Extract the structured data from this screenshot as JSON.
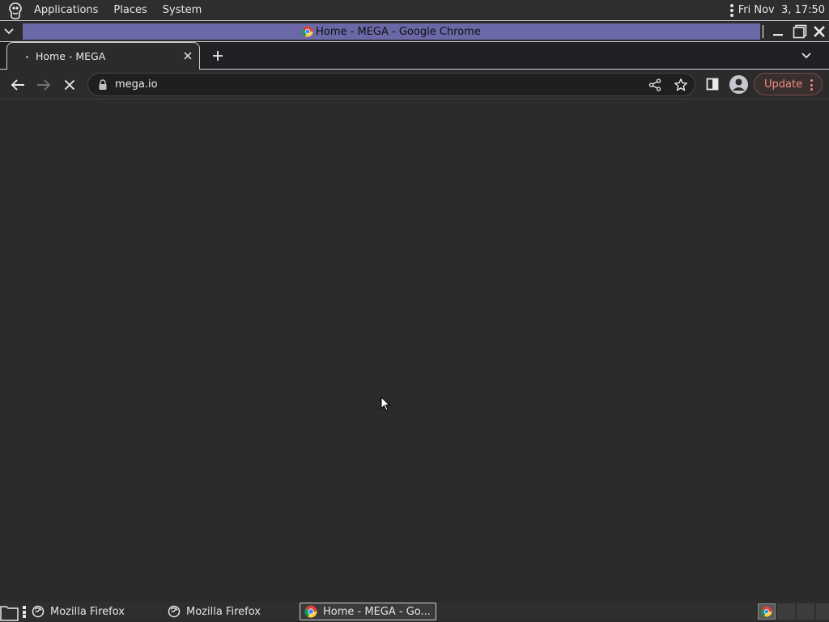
{
  "top_panel": {
    "menus": [
      "Applications",
      "Places",
      "System"
    ],
    "clock": "Fri Nov  3, 17:50"
  },
  "window": {
    "title": "Home - MEGA - Google Chrome"
  },
  "browser": {
    "tabs": [
      {
        "title": "Home - MEGA",
        "loading": true
      }
    ],
    "url": "mega.io",
    "update_label": "Update",
    "colors": {
      "titlebar_active": "#6b68a8",
      "update_text": "#f28b82",
      "page_background": "#2b2b2b"
    }
  },
  "taskbar": {
    "tasks": [
      {
        "label": "Mozilla Firefox",
        "icon": "firefox-icon",
        "active": false
      },
      {
        "label": "Mozilla Firefox",
        "icon": "firefox-icon",
        "active": false
      },
      {
        "label": "Home - MEGA - Go...",
        "icon": "chrome-icon",
        "active": true
      }
    ]
  }
}
